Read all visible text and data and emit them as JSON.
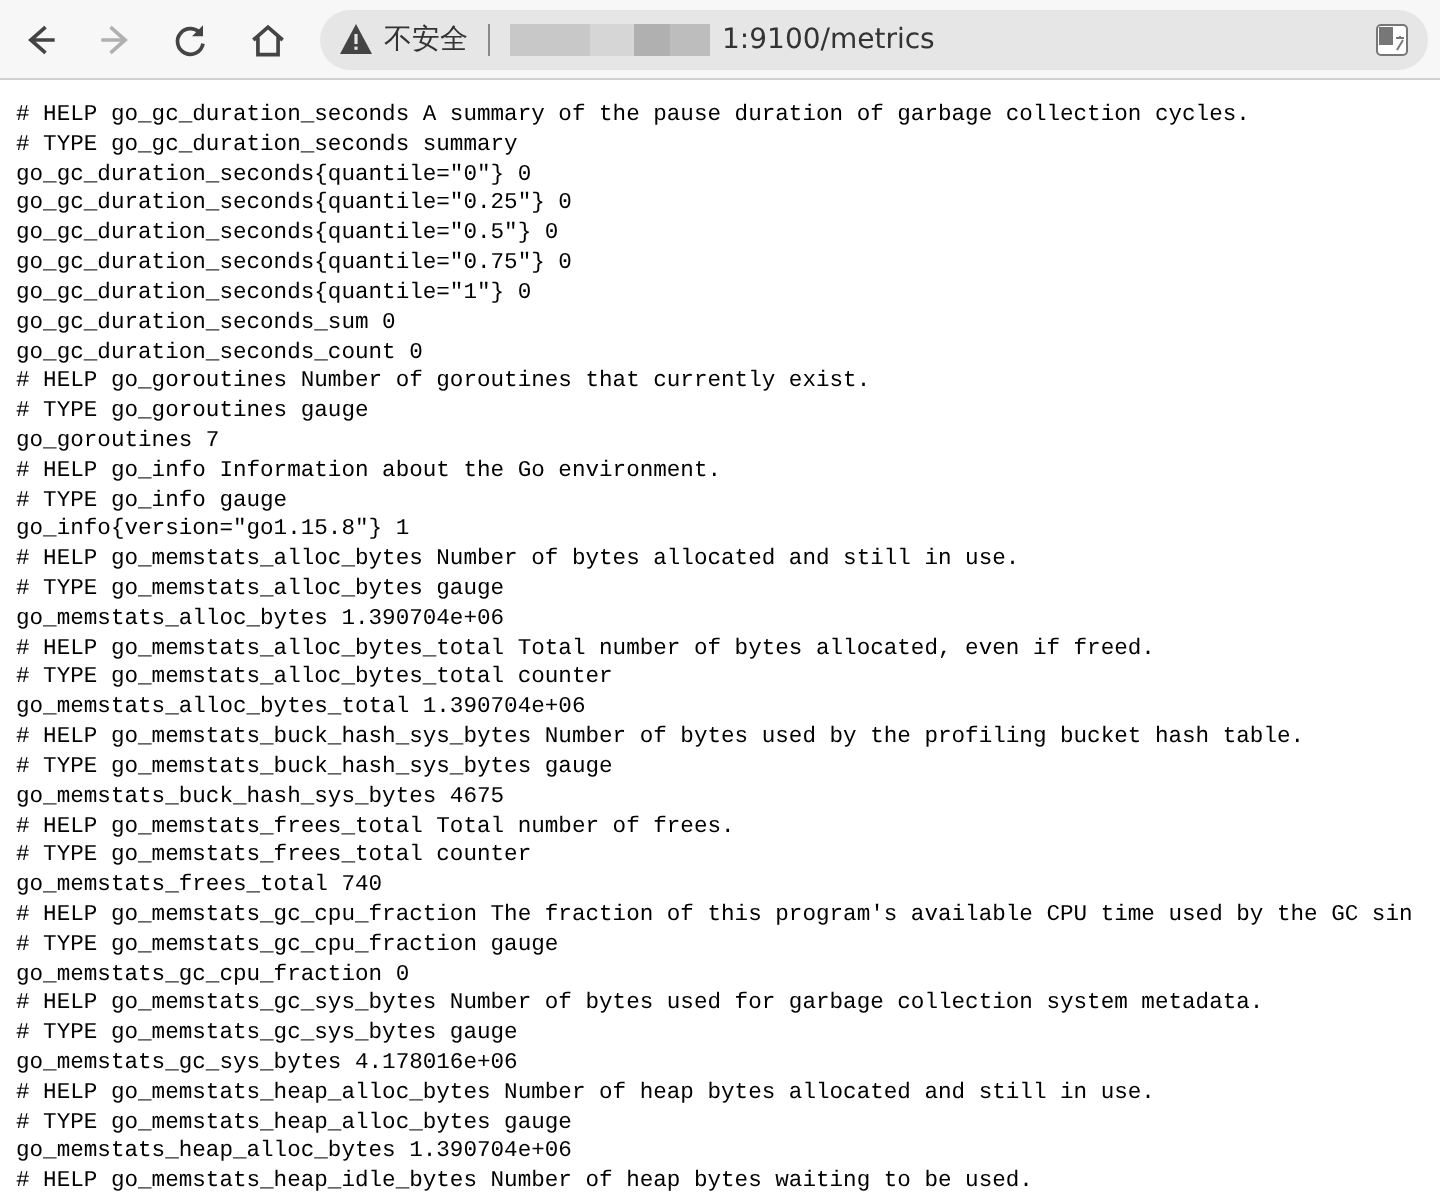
{
  "toolbar": {
    "nav_buttons": [
      {
        "kind": "back",
        "disabled": false
      },
      {
        "kind": "forward",
        "disabled": true
      },
      {
        "kind": "reload",
        "disabled": false
      },
      {
        "kind": "home",
        "disabled": false
      }
    ],
    "security_label": "不安全",
    "url": "1:9100/metrics"
  },
  "lines": [
    "# HELP go_gc_duration_seconds A summary of the pause duration of garbage collection cycles.",
    "# TYPE go_gc_duration_seconds summary",
    "go_gc_duration_seconds{quantile=\"0\"} 0",
    "go_gc_duration_seconds{quantile=\"0.25\"} 0",
    "go_gc_duration_seconds{quantile=\"0.5\"} 0",
    "go_gc_duration_seconds{quantile=\"0.75\"} 0",
    "go_gc_duration_seconds{quantile=\"1\"} 0",
    "go_gc_duration_seconds_sum 0",
    "go_gc_duration_seconds_count 0",
    "# HELP go_goroutines Number of goroutines that currently exist.",
    "# TYPE go_goroutines gauge",
    "go_goroutines 7",
    "# HELP go_info Information about the Go environment.",
    "# TYPE go_info gauge",
    "go_info{version=\"go1.15.8\"} 1",
    "# HELP go_memstats_alloc_bytes Number of bytes allocated and still in use.",
    "# TYPE go_memstats_alloc_bytes gauge",
    "go_memstats_alloc_bytes 1.390704e+06",
    "# HELP go_memstats_alloc_bytes_total Total number of bytes allocated, even if freed.",
    "# TYPE go_memstats_alloc_bytes_total counter",
    "go_memstats_alloc_bytes_total 1.390704e+06",
    "# HELP go_memstats_buck_hash_sys_bytes Number of bytes used by the profiling bucket hash table.",
    "# TYPE go_memstats_buck_hash_sys_bytes gauge",
    "go_memstats_buck_hash_sys_bytes 4675",
    "# HELP go_memstats_frees_total Total number of frees.",
    "# TYPE go_memstats_frees_total counter",
    "go_memstats_frees_total 740",
    "# HELP go_memstats_gc_cpu_fraction The fraction of this program's available CPU time used by the GC sin",
    "# TYPE go_memstats_gc_cpu_fraction gauge",
    "go_memstats_gc_cpu_fraction 0",
    "# HELP go_memstats_gc_sys_bytes Number of bytes used for garbage collection system metadata.",
    "# TYPE go_memstats_gc_sys_bytes gauge",
    "go_memstats_gc_sys_bytes 4.178016e+06",
    "# HELP go_memstats_heap_alloc_bytes Number of heap bytes allocated and still in use.",
    "# TYPE go_memstats_heap_alloc_bytes gauge",
    "go_memstats_heap_alloc_bytes 1.390704e+06",
    "# HELP go_memstats_heap_idle_bytes Number of heap bytes waiting to be used."
  ]
}
